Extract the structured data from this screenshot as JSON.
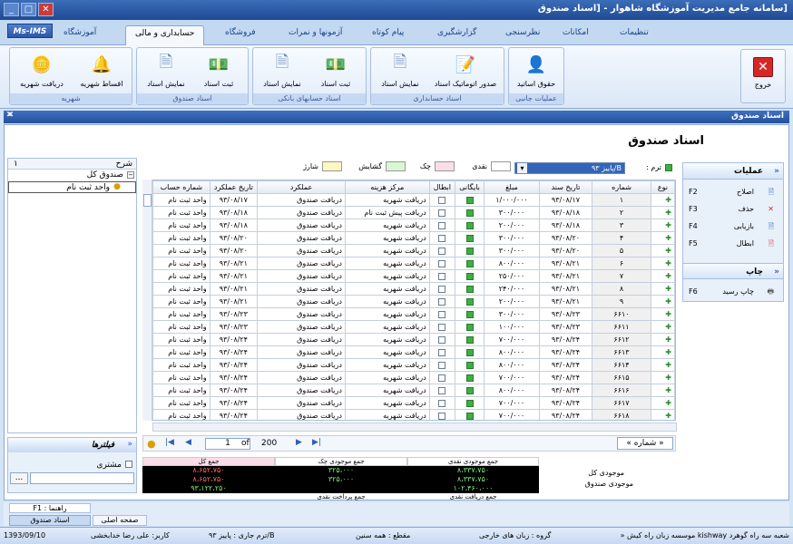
{
  "window": {
    "title": "[سامانه جامع مدیریت آموزشگاه شاهوار - [اسناد صندوق",
    "btn_min": "_",
    "btn_max": "□",
    "btn_close": "✕"
  },
  "app_logo": "Ms-IMS",
  "tabs": [
    {
      "label": "تنظیمات"
    },
    {
      "label": "امکانات"
    },
    {
      "label": "نظرسنجی"
    },
    {
      "label": "گزارشگیری"
    },
    {
      "label": "پیام کوتاه"
    },
    {
      "label": "آزمونها و نمرات"
    },
    {
      "label": "فروشگاه"
    },
    {
      "label": "حسابداری و مالی"
    },
    {
      "label": "آموزشگاه"
    }
  ],
  "ribbon": {
    "exit": "خروج",
    "groups": [
      {
        "label": "عملیات جانبی",
        "buttons": [
          {
            "label": "حقوق اساتید"
          }
        ]
      },
      {
        "label": "اسناد حسابداری",
        "buttons": [
          {
            "label": "صدور اتوماتیک اسناد"
          },
          {
            "label": "نمایش اسناد"
          }
        ]
      },
      {
        "label": "اسناد حسابهای بانکی",
        "buttons": [
          {
            "label": "ثبت اسناد"
          },
          {
            "label": "نمایش اسناد"
          }
        ]
      },
      {
        "label": "اسناد صندوق",
        "buttons": [
          {
            "label": "ثبت اسناد"
          },
          {
            "label": "نمایش اسناد"
          }
        ]
      },
      {
        "label": "شهریه",
        "buttons": [
          {
            "label": "اقساط شهریه"
          },
          {
            "label": "دریافت شهریه"
          }
        ]
      }
    ]
  },
  "doc_tab": "اسناد صندوق",
  "page_title": "اسناد صندوق",
  "legend": {
    "cash": "نقدی",
    "cheque": "چک",
    "opening": "گشایش",
    "charge": "شارژ",
    "term_label": "ترم :",
    "term_value": "B/پاییز ۹۳"
  },
  "grid": {
    "headers": [
      "نوع",
      "شماره",
      "تاریخ سند",
      "مبلغ",
      "بایگانی",
      "ابطال",
      "مرکز هزینه",
      "عملکرد",
      "تاریخ عملکرد",
      "شماره حساب"
    ],
    "rows": [
      [
        "۱",
        "۹۳/۰۸/۱۷",
        "۱/۰۰۰/۰۰۰",
        "دریافت شهریه",
        "دریافت صندوق",
        "۹۳/۰۸/۱۷",
        "واحد ثبت نام",
        ""
      ],
      [
        "۲",
        "۹۳/۰۸/۱۸",
        "۳۰۰/۰۰۰",
        "دریافت پیش ثبت نام",
        "دریافت صندوق",
        "۹۳/۰۸/۱۸",
        "واحد ثبت نام",
        ""
      ],
      [
        "۳",
        "۹۳/۰۸/۱۸",
        "۲۰۰/۰۰۰",
        "دریافت شهریه",
        "دریافت صندوق",
        "۹۳/۰۸/۱۸",
        "واحد ثبت نام",
        ""
      ],
      [
        "۴",
        "۹۳/۰۸/۲۰",
        "۳۰۰/۰۰۰",
        "دریافت شهریه",
        "دریافت صندوق",
        "۹۳/۰۸/۲۰",
        "واحد ثبت نام",
        ""
      ],
      [
        "۵",
        "۹۳/۰۸/۲۰",
        "۳۰۰/۰۰۰",
        "دریافت شهریه",
        "دریافت صندوق",
        "۹۳/۰۸/۲۰",
        "واحد ثبت نام",
        ""
      ],
      [
        "۶",
        "۹۳/۰۸/۲۱",
        "۸۰۰/۰۰۰",
        "دریافت شهریه",
        "دریافت صندوق",
        "۹۳/۰۸/۲۱",
        "واحد ثبت نام",
        ""
      ],
      [
        "۷",
        "۹۳/۰۸/۲۱",
        "۲۵۰/۰۰۰",
        "دریافت شهریه",
        "دریافت صندوق",
        "۹۳/۰۸/۲۱",
        "واحد ثبت نام",
        ""
      ],
      [
        "۸",
        "۹۳/۰۸/۲۱",
        "۲۴۰/۰۰۰",
        "دریافت شهریه",
        "دریافت صندوق",
        "۹۳/۰۸/۲۱",
        "واحد ثبت نام",
        ""
      ],
      [
        "۹",
        "۹۳/۰۸/۲۱",
        "۲۰۰/۰۰۰",
        "دریافت شهریه",
        "دریافت صندوق",
        "۹۳/۰۸/۲۱",
        "واحد ثبت نام",
        ""
      ],
      [
        "۶۶۱۰",
        "۹۳/۰۸/۲۳",
        "۳۰۰/۰۰۰",
        "دریافت شهریه",
        "دریافت صندوق",
        "۹۳/۰۸/۲۳",
        "واحد ثبت نام",
        ""
      ],
      [
        "۶۶۱۱",
        "۹۳/۰۸/۲۳",
        "۱۰۰/۰۰۰",
        "دریافت شهریه",
        "دریافت صندوق",
        "۹۳/۰۸/۲۳",
        "واحد ثبت نام",
        ""
      ],
      [
        "۶۶۱۲",
        "۹۳/۰۸/۲۴",
        "۷۰۰/۰۰۰",
        "دریافت شهریه",
        "دریافت صندوق",
        "۹۳/۰۸/۲۴",
        "واحد ثبت نام",
        ""
      ],
      [
        "۶۶۱۳",
        "۹۳/۰۸/۲۴",
        "۸۰۰/۰۰۰",
        "دریافت شهریه",
        "دریافت صندوق",
        "۹۳/۰۸/۲۴",
        "واحد ثبت نام",
        ""
      ],
      [
        "۶۶۱۴",
        "۹۳/۰۸/۲۴",
        "۸۰۰/۰۰۰",
        "دریافت شهریه",
        "دریافت صندوق",
        "۹۳/۰۸/۲۴",
        "واحد ثبت نام",
        ""
      ],
      [
        "۶۶۱۵",
        "۹۳/۰۸/۲۴",
        "۷۰۰/۰۰۰",
        "دریافت شهریه",
        "دریافت صندوق",
        "۹۳/۰۸/۲۴",
        "واحد ثبت نام",
        ""
      ],
      [
        "۶۶۱۶",
        "۹۳/۰۸/۲۴",
        "۸۰۰/۰۰۰",
        "دریافت شهریه",
        "دریافت صندوق",
        "۹۳/۰۸/۲۴",
        "واحد ثبت نام",
        ""
      ],
      [
        "۶۶۱۷",
        "۹۳/۰۸/۲۴",
        "۷۰۰/۰۰۰",
        "دریافت شهریه",
        "دریافت صندوق",
        "۹۳/۰۸/۲۴",
        "واحد ثبت نام",
        ""
      ],
      [
        "۶۶۱۸",
        "۹۳/۰۸/۲۴",
        "۷۰۰/۰۰۰",
        "دریافت شهریه",
        "دریافت صندوق",
        "۹۳/۰۸/۲۴",
        "واحد ثبت نام",
        ""
      ],
      [
        "۶۶۱۹",
        "۹۳/۰۸/۲۴",
        "۷۵۰/۰۰۰",
        "دریافت شهریه",
        "دریافت صندوق",
        "۹۳/۰۸/۲۴",
        "واحد ثبت نام",
        ""
      ]
    ]
  },
  "nav": {
    "page": "1",
    "of": "of",
    "total": "200",
    "sort": "« شماره »"
  },
  "tree": {
    "header_desc": "شرح",
    "header_num": "۱",
    "root": "صندوق کل",
    "child": "واحد ثبت نام"
  },
  "filters": {
    "title": "فیلترها",
    "customer": "مشتری",
    "more": "..."
  },
  "ops": {
    "title": "عملیات",
    "items": [
      {
        "label": "اصلاح",
        "key": "F2"
      },
      {
        "label": "حذف",
        "key": "F3"
      },
      {
        "label": "بازیابی",
        "key": "F4"
      },
      {
        "label": "ابطال",
        "key": "F5"
      }
    ],
    "print_title": "چاپ",
    "print_items": [
      {
        "label": "چاپ رسید",
        "key": "F6"
      }
    ]
  },
  "totals": {
    "row1_label": "موجودی کل",
    "row2_label": "موجودی صندوق",
    "h_cash": "جمع موجودی نقدی",
    "h_cheque": "جمع موجودی چک",
    "h_total": "جمع کل",
    "v_cash": "۸،۳۳۷،۷۵۰",
    "v_cheque": "۳۲۵،۰۰۰",
    "v_total": "۸،۶۵۲،۷۵۰",
    "v_cash2": "۸،۳۳۷،۷۵۰",
    "v_cheque2": "۳۲۵،۰۰۰",
    "v_total2": "۸،۶۵۲،۷۵۰",
    "v_recv": "۱۰۲،۴۶۰،۰۰۰",
    "v_pay": "",
    "v_sum3": "۹۳،۱۲۲،۲۵۰",
    "f_recv": "جمع دریافت نقدی",
    "f_pay": "جمع پرداخت نقدی"
  },
  "bottom_tabs": {
    "help": "راهنما : F1",
    "tab1": "اسناد صندوق",
    "tab2": "صفحه اصلی"
  },
  "status": {
    "branch": "شعبه سه راه گوهرد kishway موسسه زبان راه کیش «",
    "group": "گروه : زبان های خارجی",
    "grade": "مقطع : همه سنین",
    "term": "B/ترم جاری : پاییز ۹۳",
    "user": "کاربر: علی رضا خدابخشی",
    "date": "1393/09/10"
  }
}
